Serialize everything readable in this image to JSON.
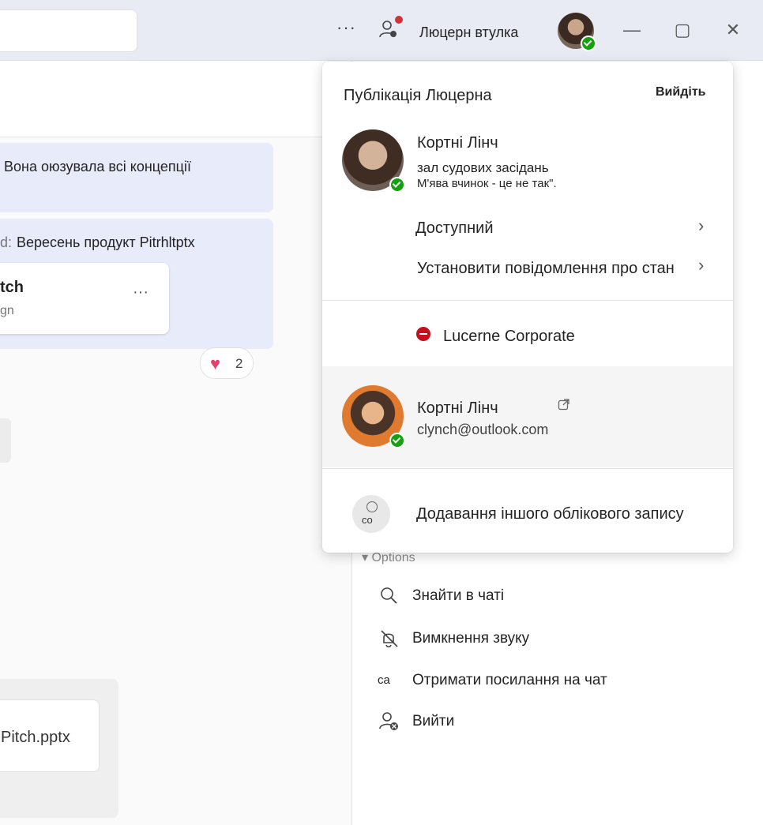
{
  "titlebar": {
    "more_label": "···",
    "org_name": "Люцерн втулка",
    "minimize_label": "—",
    "maximize_label": "▢",
    "close_label": "✕"
  },
  "chat": {
    "message1": "Вона оюзувала всі концепції",
    "message2_prefix": "d:",
    "message2": "Вересень продукт Pitrhltptx",
    "card_title": "tch",
    "card_sub": "gn",
    "card_more": "···",
    "reaction_emoji": "♥",
    "reaction_count": "2",
    "file_name": "Pitch.pptx"
  },
  "options": {
    "header": "▾ Options",
    "items": [
      {
        "label": "Знайти в чаті",
        "icon": "search-icon"
      },
      {
        "label": "Вимкнення звуку",
        "icon": "bell-off-icon"
      },
      {
        "label": "Отримати посилання на чат",
        "icon": "link-icon",
        "icon_text": "ca"
      },
      {
        "label": "Вийти",
        "icon": "leave-icon"
      }
    ]
  },
  "dropdown": {
    "org_title": "Публікація Люцерна",
    "sign_out": "Вийдіть",
    "user_name": "Кортні Лінч",
    "status_line1": "зал судових засідань",
    "status_line2": "М'ява вчинок - це не так\".",
    "availability": "Доступний",
    "set_status": "Установити повідомлення про стан",
    "org_switch": "Lucerne Corporate",
    "account_name": "Кортні Лінч",
    "account_email": "clynch@outlook.com",
    "add_account_icon_text": "co",
    "add_account": "Додавання іншого облікового запису"
  },
  "colors": {
    "presence_available": "#13a10e",
    "dnd": "#c50f1f",
    "bubble": "#e8ebfa",
    "reaction_heart": "#e63e6d"
  }
}
